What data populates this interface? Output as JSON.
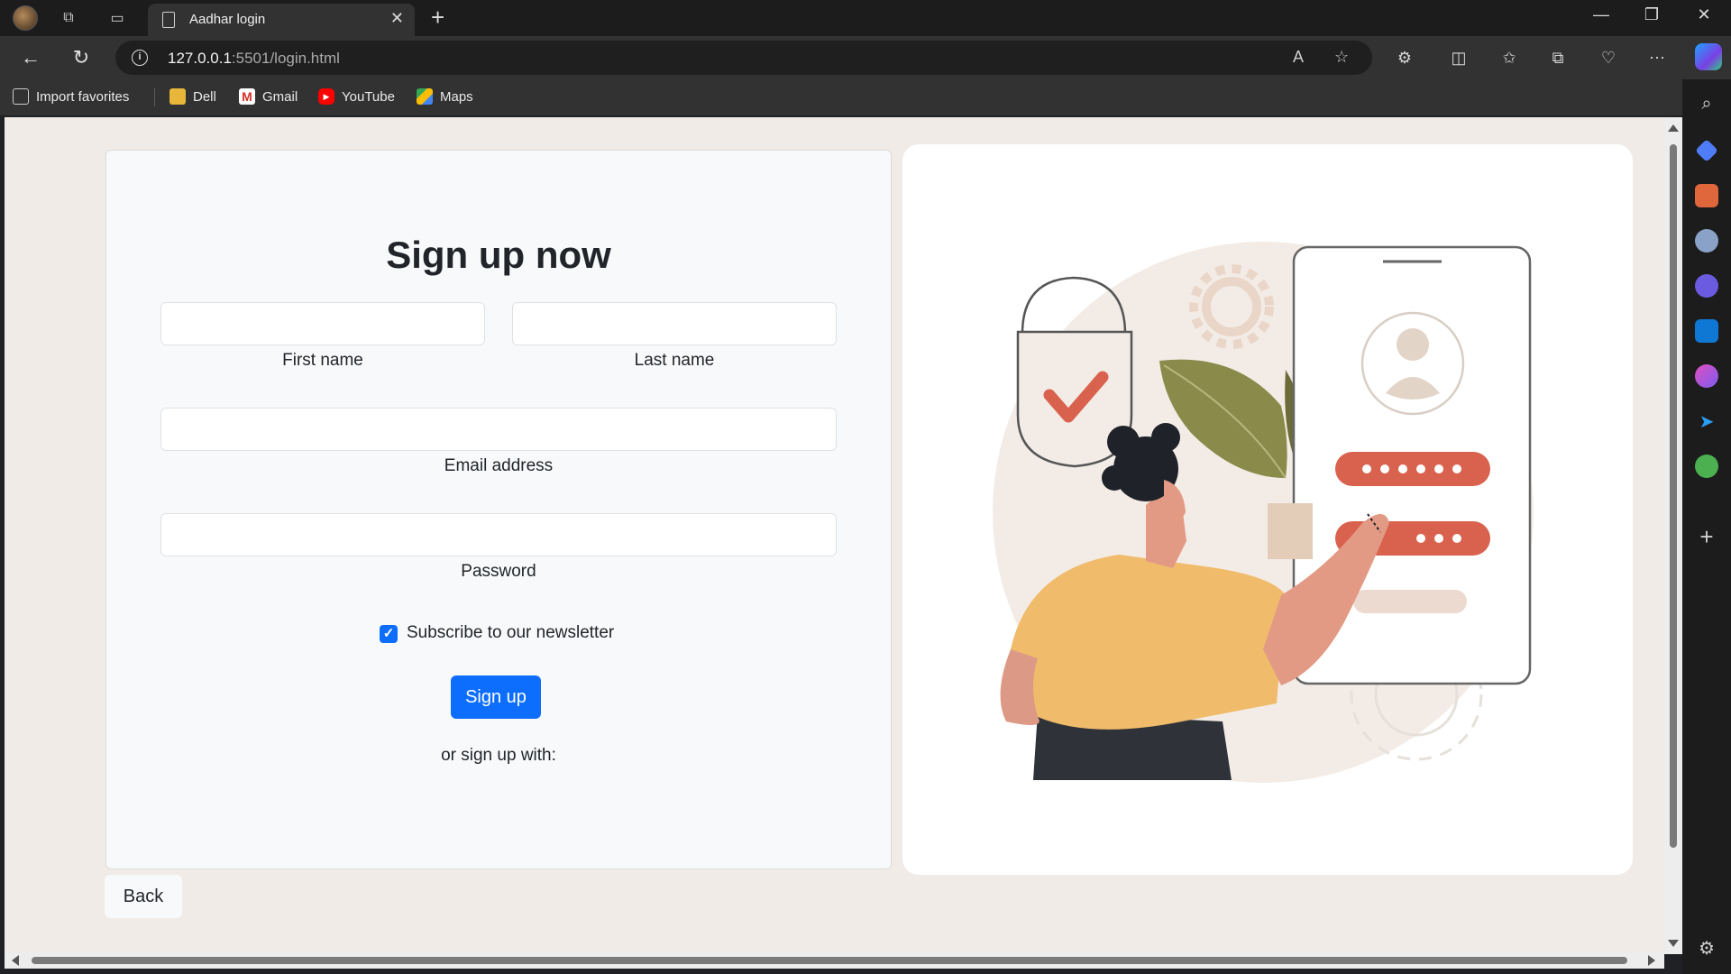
{
  "browser": {
    "tab_title": "Aadhar login",
    "close_tab": "✕",
    "new_tab": "+",
    "url_host": "127.0.0.1",
    "url_rest": ":5501/login.html",
    "window_controls": [
      "—",
      "❐",
      "✕"
    ]
  },
  "bookmarks": {
    "import": "Import favorites",
    "items": [
      "Dell",
      "Gmail",
      "YouTube",
      "Maps"
    ]
  },
  "form": {
    "heading": "Sign up now",
    "first_name": {
      "label": "First name",
      "value": ""
    },
    "last_name": {
      "label": "Last name",
      "value": ""
    },
    "email": {
      "label": "Email address",
      "value": ""
    },
    "password": {
      "label": "Password",
      "value": ""
    },
    "newsletter": {
      "label": "Subscribe to our newsletter",
      "checked": true
    },
    "submit_label": "Sign up",
    "alt_text": "or sign up with:"
  },
  "back_label": "Back",
  "colors": {
    "primary": "#0d6efd",
    "page_bg": "#f0ebe6",
    "accent_red": "#d9624e",
    "accent_yellow": "#f0bb6a"
  },
  "icons": [
    "back-arrow-icon",
    "refresh-icon",
    "info-icon",
    "star-icon",
    "extensions-icon",
    "split-screen-icon",
    "favorites-icon",
    "collections-icon",
    "health-icon",
    "more-icon",
    "search-icon",
    "settings-icon",
    "plus-icon",
    "checkmark-icon"
  ]
}
